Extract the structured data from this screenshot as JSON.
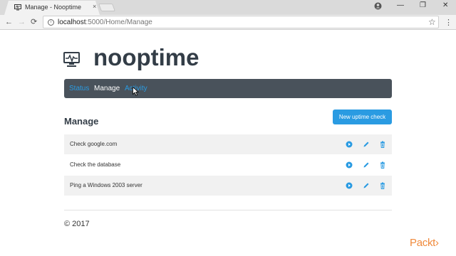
{
  "browser": {
    "tab_title": "Manage - Nooptime",
    "tab_close": "×",
    "url_host": "localhost",
    "url_path": ":5000/Home/Manage",
    "back": "←",
    "forward": "→",
    "reload": "⟳",
    "star": "☆",
    "menu": "⋮",
    "info": "i",
    "minimize": "—",
    "restore": "❐",
    "close": "✕"
  },
  "brand": {
    "name": "nooptime"
  },
  "nav": {
    "status": "Status",
    "manage": "Manage",
    "activity": "Activity"
  },
  "manage": {
    "title": "Manage",
    "new_button": "New uptime check",
    "checks": [
      {
        "label": "Check google.com"
      },
      {
        "label": "Check the database"
      },
      {
        "label": "Ping a Windows 2003 server"
      }
    ]
  },
  "footer": {
    "text": "© 2017"
  },
  "watermark": "Packt›",
  "colors": {
    "accent": "#2a9be2",
    "navbar": "#49525b",
    "brand": "#333d47",
    "watermark": "#f08a3c"
  },
  "icons": [
    "monitor-icon",
    "play-icon",
    "pencil-icon",
    "trash-icon",
    "star-icon",
    "profile-icon"
  ]
}
